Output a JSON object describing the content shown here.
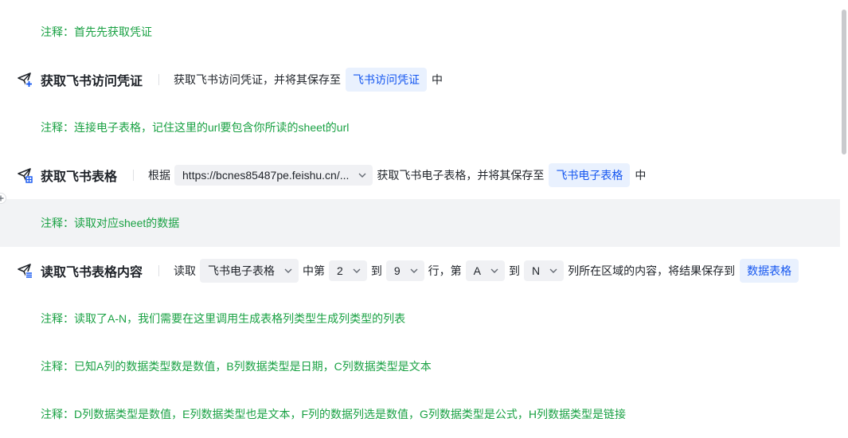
{
  "rows": {
    "comment1": "注释：首先先获取凭证",
    "step1": {
      "title": "获取飞书访问凭证",
      "desc": "获取飞书访问凭证，并将其保存至",
      "var": "飞书访问凭证",
      "suffix": "中"
    },
    "comment2": "注释：连接电子表格，记住这里的url要包含你所读的sheet的url",
    "step2": {
      "title": "获取飞书表格",
      "prefix": "根据",
      "url_select": "https://bcnes85487pe.feishu.cn/...",
      "desc": "获取飞书电子表格，并将其保存至",
      "var": "飞书电子表格",
      "suffix": "中"
    },
    "comment3": "注释：读取对应sheet的数据",
    "step3": {
      "title": "读取飞书表格内容",
      "read": "读取",
      "sheet_select": "飞书电子表格",
      "from_text": "中第",
      "row_start": "2",
      "to1": "到",
      "row_end": "9",
      "row_col_text": "行，第",
      "col_start": "A",
      "to2": "到",
      "col_end": "N",
      "tail": "列所在区域的内容，将结果保存到",
      "var": "数据表格"
    },
    "comment4": "注释：读取了A-N，我们需要在这里调用生成表格列类型生成列类型的列表",
    "comment5": "注释：已知A列的数据类型数是数值，B列数据类型是日期，C列数据类型是文本",
    "comment6": "注释：D列数据类型是数值，E列数据类型也是文本，F列的数据列选是数值，G列数据类型是公式，H列数据类型是链接"
  },
  "icons": {
    "step1": "send-add-icon",
    "step2": "send-table-icon",
    "step3": "send-list-icon",
    "dropdown": "chevron-down-icon",
    "handle": "plus-icon"
  },
  "colors": {
    "comment": "#19a143",
    "variable_bg": "#e9f1fe",
    "variable_text": "#1456f0",
    "select_bg": "#f0f1f4",
    "highlight_row": "#f2f3f5"
  }
}
